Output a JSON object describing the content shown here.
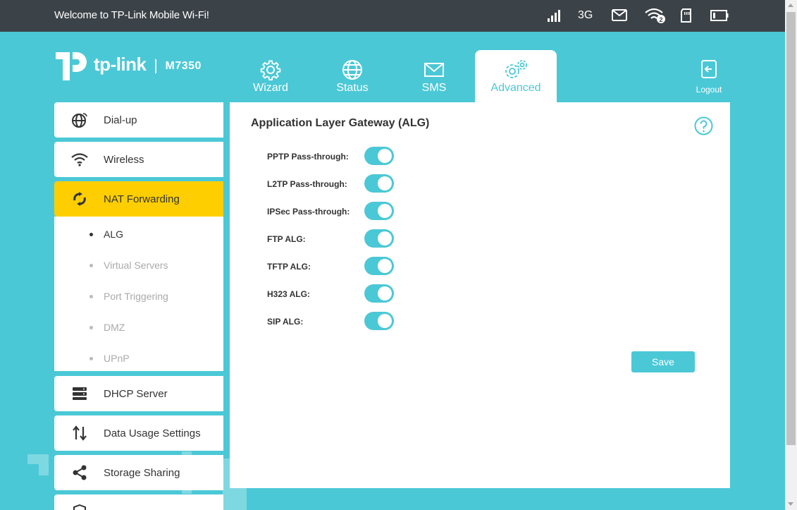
{
  "topbar": {
    "welcome": "Welcome to TP-Link Mobile Wi-Fi!",
    "network_type": "3G",
    "connected_clients": "2",
    "icons": [
      "signal-icon",
      "mail-icon",
      "wifi-icon",
      "sd-card-icon",
      "battery-icon"
    ]
  },
  "brand": {
    "logo_text": "tp-link",
    "model": "M7350"
  },
  "tabs": [
    {
      "label": "Wizard",
      "icon": "gear-icon"
    },
    {
      "label": "Status",
      "icon": "globe-icon"
    },
    {
      "label": "SMS",
      "icon": "mail-icon"
    },
    {
      "label": "Advanced",
      "icon": "gears-icon",
      "active": true
    }
  ],
  "logout": {
    "label": "Logout",
    "icon": "logout-icon"
  },
  "sidebar": {
    "items": [
      {
        "label": "Dial-up",
        "icon": "globe-dialup-icon"
      },
      {
        "label": "Wireless",
        "icon": "wifi-icon"
      },
      {
        "label": "NAT Forwarding",
        "icon": "nat-icon",
        "active": true
      },
      {
        "label": "DHCP Server",
        "icon": "server-icon"
      },
      {
        "label": "Data Usage Settings",
        "icon": "arrows-updown-icon"
      },
      {
        "label": "Storage Sharing",
        "icon": "share-icon"
      }
    ],
    "sub_items": [
      {
        "label": "ALG",
        "current": true
      },
      {
        "label": "Virtual Servers"
      },
      {
        "label": "Port Triggering"
      },
      {
        "label": "DMZ"
      },
      {
        "label": "UPnP"
      }
    ]
  },
  "content": {
    "title": "Application Layer Gateway (ALG)",
    "help_icon": "help-icon",
    "rows": [
      {
        "label": "PPTP Pass-through:",
        "enabled": true
      },
      {
        "label": "L2TP Pass-through:",
        "enabled": true
      },
      {
        "label": "IPSec Pass-through:",
        "enabled": true
      },
      {
        "label": "FTP ALG:",
        "enabled": true
      },
      {
        "label": "TFTP ALG:",
        "enabled": true
      },
      {
        "label": "H323 ALG:",
        "enabled": true
      },
      {
        "label": "SIP ALG:",
        "enabled": true
      }
    ],
    "save_label": "Save"
  },
  "colors": {
    "accent": "#4bc8d6",
    "topbar": "#3b4248",
    "active_menu": "#ffce00"
  }
}
